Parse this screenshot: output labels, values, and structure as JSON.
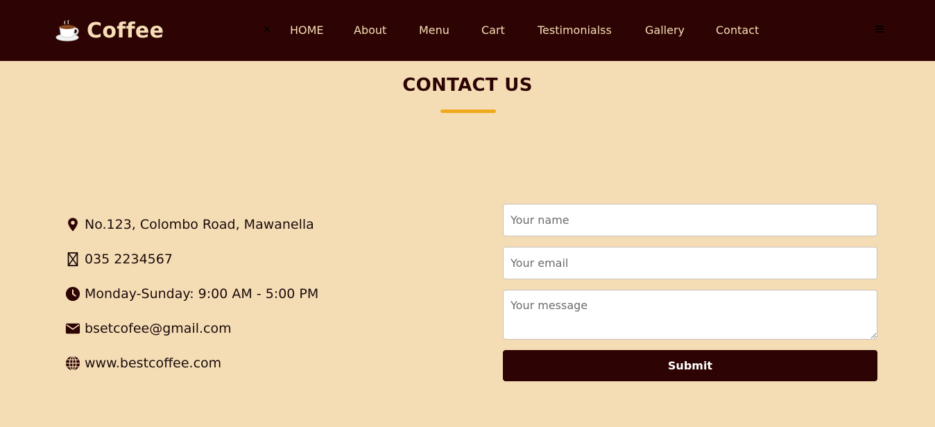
{
  "brand": {
    "name": "Coffee",
    "icon": "coffee-cup-icon"
  },
  "nav": {
    "close_icon": "close-icon",
    "items": [
      {
        "label": "HOME"
      },
      {
        "label": "About"
      },
      {
        "label": "Menu"
      },
      {
        "label": "Cart"
      },
      {
        "label": "Testimonialss"
      },
      {
        "label": "Gallery"
      },
      {
        "label": "Contact"
      }
    ],
    "menu_icon": "hamburger-icon"
  },
  "section": {
    "title": "CONTACT US"
  },
  "contact_info": [
    {
      "icon": "location-pin-icon",
      "text": "No.123, Colombo Road, Mawanella"
    },
    {
      "icon": "phone-icon",
      "text": "035 2234567"
    },
    {
      "icon": "clock-icon",
      "text": "Monday-Sunday: 9:00 AM - 5:00 PM"
    },
    {
      "icon": "envelope-icon",
      "text": "bsetcofee@gmail.com"
    },
    {
      "icon": "globe-icon",
      "text": "www.bestcoffee.com"
    }
  ],
  "form": {
    "name_placeholder": "Your name",
    "email_placeholder": "Your email",
    "message_placeholder": "Your message",
    "submit_label": "Submit"
  },
  "colors": {
    "navbar_bg": "#2d0303",
    "page_bg": "#f4ddb5",
    "nav_text": "#f6dfb6",
    "accent": "#f0a81d",
    "button_bg": "#2d0303"
  }
}
